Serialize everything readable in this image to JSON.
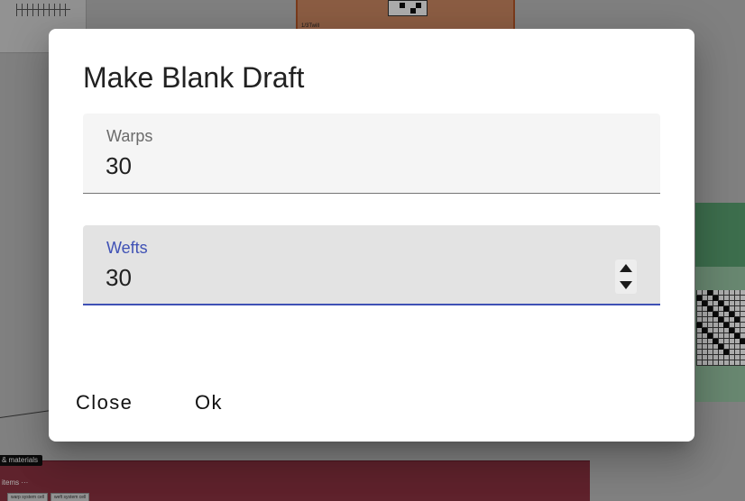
{
  "dialog": {
    "title": "Make Blank Draft",
    "warps": {
      "label": "Warps",
      "value": "30"
    },
    "wefts": {
      "label": "Wefts",
      "value": "30"
    },
    "close_label": "Close",
    "ok_label": "Ok"
  },
  "background": {
    "orange_node_label": "1/3Twill",
    "tag_label": "& materials",
    "red_node_title": "items ···",
    "chips": [
      "warp system cell",
      "weft system cell"
    ]
  },
  "colors": {
    "accent": "#3f51b5",
    "orange_node": "#cf8a63",
    "green_node": "#5aa272",
    "red_node": "#8c3341"
  },
  "icons": [
    "spinner-up-arrow-icon",
    "spinner-down-arrow-icon"
  ]
}
